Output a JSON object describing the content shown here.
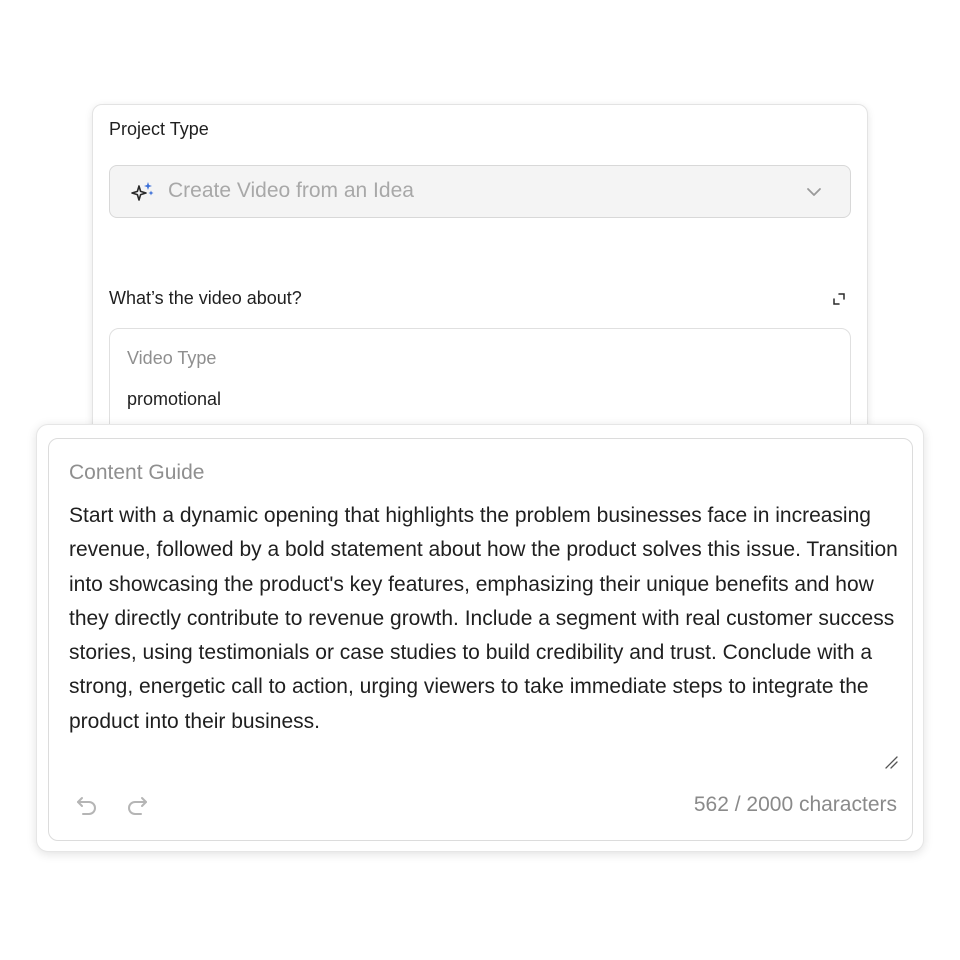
{
  "project_type": {
    "label": "Project Type",
    "selected_value": "Create Video from an Idea",
    "icon": "sparkle-icon"
  },
  "video_about": {
    "label": "What’s the video about?",
    "video_type": {
      "label": "Video Type",
      "value": "promotional"
    }
  },
  "content_guide": {
    "label": "Content Guide",
    "text": "Start with a dynamic opening that highlights the problem businesses face in increasing revenue, followed by a bold statement about how the product solves this issue. Transition into showcasing the product's key features, emphasizing their unique benefits and how they directly contribute to revenue growth. Include a segment with real customer success stories, using testimonials or case studies to build credibility and trust. Conclude with a strong, energetic call to action, urging viewers to take immediate steps to integrate the product into their business.",
    "char_count": "562 / 2000 characters"
  },
  "colors": {
    "accent_blue": "#3b6fd8",
    "muted_text": "#8f8f8f",
    "placeholder_text": "#a8a8a8"
  }
}
